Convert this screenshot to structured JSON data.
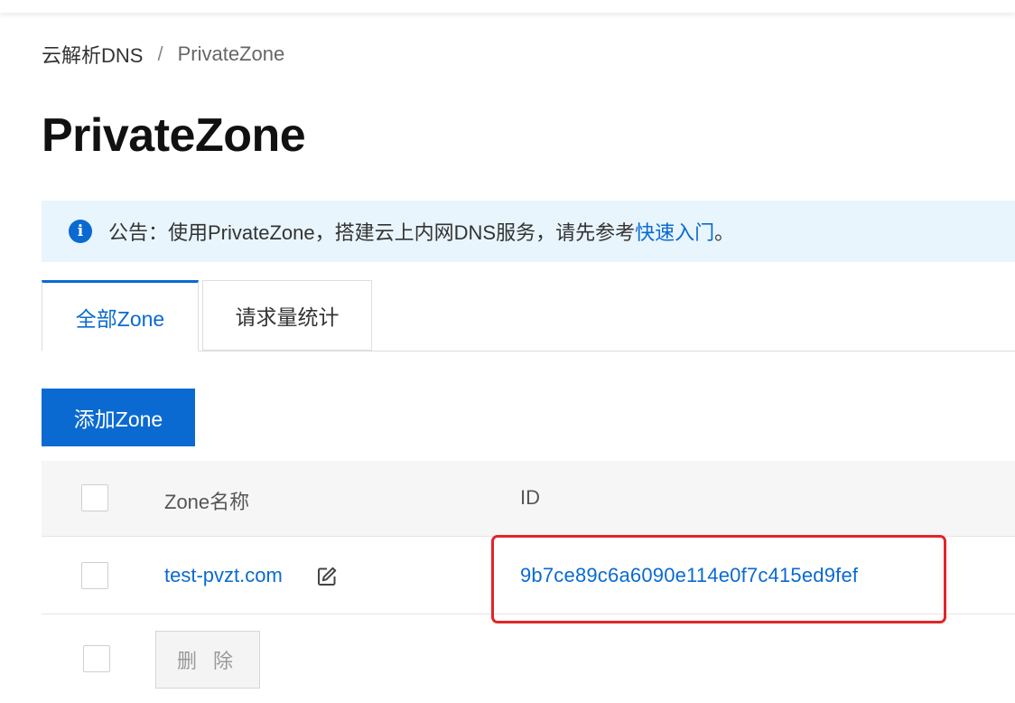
{
  "breadcrumb": {
    "root": "云解析DNS",
    "separator": "/",
    "current": "PrivateZone"
  },
  "page": {
    "title": "PrivateZone"
  },
  "notice": {
    "icon": "info-icon",
    "text": "公告：使用PrivateZone，搭建云上内网DNS服务，请先参考",
    "link_text": "快速入门",
    "suffix": "。"
  },
  "tabs": [
    {
      "label": "全部Zone",
      "active": true
    },
    {
      "label": "请求量统计",
      "active": false
    }
  ],
  "toolbar": {
    "add_label": "添加Zone"
  },
  "table": {
    "columns": {
      "name": "Zone名称",
      "id": "ID"
    },
    "rows": [
      {
        "zone_name": "test-pvzt.com",
        "id": "9b7ce89c6a6090e114e0f7c415ed9fef"
      }
    ],
    "delete_label": "删 除"
  },
  "colors": {
    "accent": "#0a6ad1",
    "highlight": "#e0262a",
    "notice_bg": "#e8f5fc"
  }
}
